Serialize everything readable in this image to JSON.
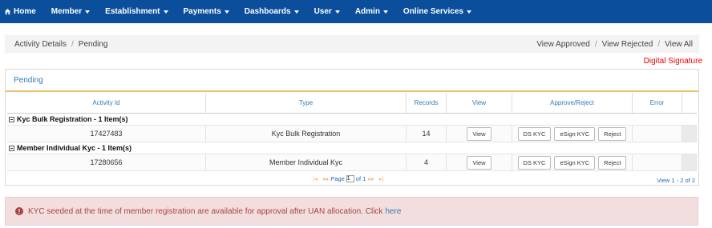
{
  "navbar": {
    "items": [
      {
        "label": "Home",
        "has_caret": false
      },
      {
        "label": "Member",
        "has_caret": true
      },
      {
        "label": "Establishment",
        "has_caret": true
      },
      {
        "label": "Payments",
        "has_caret": true
      },
      {
        "label": "Dashboards",
        "has_caret": true
      },
      {
        "label": "User",
        "has_caret": true
      },
      {
        "label": "Admin",
        "has_caret": true
      },
      {
        "label": "Online Services",
        "has_caret": true
      }
    ],
    "bg_color": "#0b4f9c"
  },
  "breadcrumb": {
    "items": [
      "Activity Details",
      "Pending"
    ],
    "separator": "/",
    "views": [
      "View Approved",
      "View Rejected",
      "View All"
    ]
  },
  "digital_signature": "Digital Signature",
  "panel": {
    "title": "Pending",
    "columns": [
      "Activity Id",
      "Type",
      "Records",
      "View",
      "Approve/Reject",
      "Error"
    ],
    "groups": [
      {
        "label": "Kyc Bulk Registration - 1 Item(s)",
        "rows": [
          {
            "activity_id": "17427483",
            "type": "Kyc Bulk Registration",
            "records": "14"
          }
        ]
      },
      {
        "label": "Member Individual Kyc - 1 Item(s)",
        "rows": [
          {
            "activity_id": "17280656",
            "type": "Member Individual Kyc",
            "records": "4"
          }
        ]
      }
    ],
    "buttons": {
      "view": "View",
      "ds_kyc": "DS KYC",
      "esign_kyc": "eSign KYC",
      "reject": "Reject"
    },
    "pager": {
      "page_label": "Page",
      "page_value": "1",
      "of_label": "of 1"
    },
    "view_count": "View 1 - 2 of 2"
  },
  "alert": {
    "text": "KYC seeded at the time of member registration are available for approval after UAN allocation. Click",
    "link": "here"
  }
}
